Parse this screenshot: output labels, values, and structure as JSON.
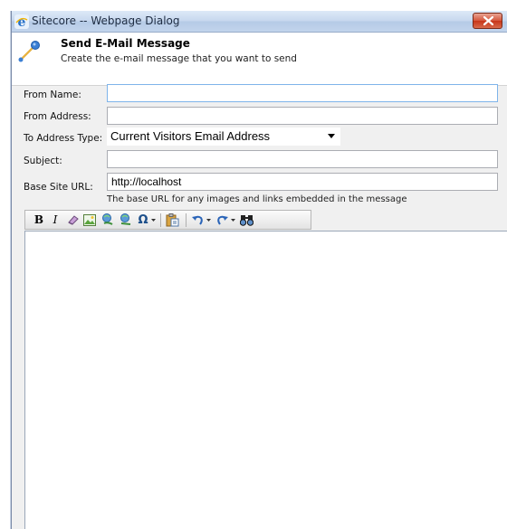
{
  "window": {
    "title": "Sitecore -- Webpage Dialog"
  },
  "header": {
    "title": "Send E-Mail Message",
    "subtitle": "Create the e-mail message that you want to send"
  },
  "form": {
    "from_name": {
      "label": "From Name:",
      "value": ""
    },
    "from_address": {
      "label": "From Address:",
      "value": ""
    },
    "to_address_type": {
      "label": "To Address Type:",
      "value": "Current Visitors Email Address"
    },
    "subject": {
      "label": "Subject:",
      "value": ""
    },
    "base_site_url": {
      "label": "Base Site URL:",
      "value": "http://localhost",
      "hint": "The base URL for any images and links embedded in the message"
    }
  },
  "toolbar": {
    "buttons": [
      "bold-icon",
      "italic-icon",
      "eraser-icon",
      "image-icon",
      "link-icon",
      "unlink-icon",
      "omega-icon",
      "paste-icon",
      "undo-icon",
      "redo-icon",
      "find-icon"
    ],
    "bold_label": "B",
    "italic_label": "I",
    "omega_label": "Ω"
  },
  "colors": {
    "close_button": "#c7361a",
    "focus_border": "#7eb4ea",
    "window_bg": "#f0f0f0"
  }
}
